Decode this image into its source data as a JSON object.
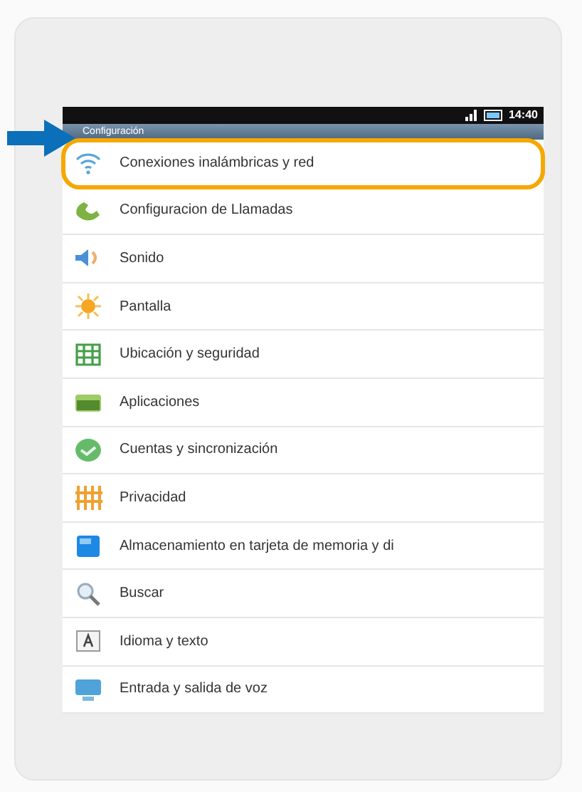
{
  "status_bar": {
    "time": "14:40"
  },
  "title": "Configuración",
  "items": [
    {
      "label": "Conexiones inalámbricas y red",
      "highlighted": true
    },
    {
      "label": "Configuracion de Llamadas",
      "highlighted": false
    },
    {
      "label": "Sonido",
      "highlighted": false
    },
    {
      "label": "Pantalla",
      "highlighted": false
    },
    {
      "label": "Ubicación y seguridad",
      "highlighted": false
    },
    {
      "label": "Aplicaciones",
      "highlighted": false
    },
    {
      "label": "Cuentas y sincronización",
      "highlighted": false
    },
    {
      "label": "Privacidad",
      "highlighted": false
    },
    {
      "label": "Almacenamiento en tarjeta de memoria y di",
      "highlighted": false
    },
    {
      "label": "Buscar",
      "highlighted": false
    },
    {
      "label": "Idioma y texto",
      "highlighted": false
    },
    {
      "label": "Entrada y salida de voz",
      "highlighted": false
    }
  ]
}
